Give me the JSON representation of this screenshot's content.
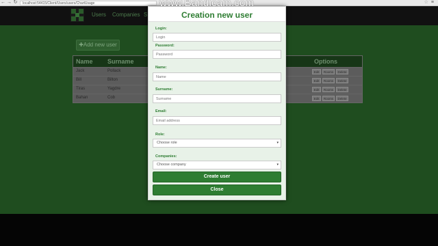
{
  "browser": {
    "url": "localhost:54415/Client/Users/users/ChartUsage",
    "back_glyph": "←",
    "forward_glyph": "→",
    "reload_glyph": "↻",
    "star_glyph": "☆",
    "menu_glyph": "≡"
  },
  "navbar": {
    "links": [
      "Users",
      "Companies",
      "S"
    ]
  },
  "page": {
    "add_user_label": "✚Add new user",
    "table": {
      "headers": [
        "Name",
        "Surname",
        "Options"
      ],
      "rows": [
        {
          "name": "Jack",
          "surname": "Pollack"
        },
        {
          "name": "Bill",
          "surname": "Bilton"
        },
        {
          "name": "Tiras",
          "surname": "Yagdre"
        },
        {
          "name": "Bahan",
          "surname": "Cob"
        }
      ],
      "option_labels": [
        "Edit",
        "Rooms",
        "Delete"
      ]
    }
  },
  "modal": {
    "title": "Creation new user",
    "fields": {
      "login": {
        "label": "Login:",
        "placeholder": "Login"
      },
      "password": {
        "label": "Password:",
        "placeholder": "Password"
      },
      "name": {
        "label": "Name:",
        "placeholder": "Name"
      },
      "surname": {
        "label": "Surname:",
        "placeholder": "Surname"
      },
      "email": {
        "label": "Email:",
        "placeholder": "Email address"
      },
      "role": {
        "label": "Role:",
        "value": "Choose role"
      },
      "companies": {
        "label": "Companies:",
        "value": "Choose company"
      }
    },
    "create_label": "Create user",
    "close_label": "Close",
    "select_arrow": "▾"
  },
  "watermark": "www.Bandicam.com",
  "colors": {
    "accent_green": "#2e7d32",
    "modal_bg": "#e8f2e8",
    "page_bg_dimmed": "#1f4d1f"
  }
}
